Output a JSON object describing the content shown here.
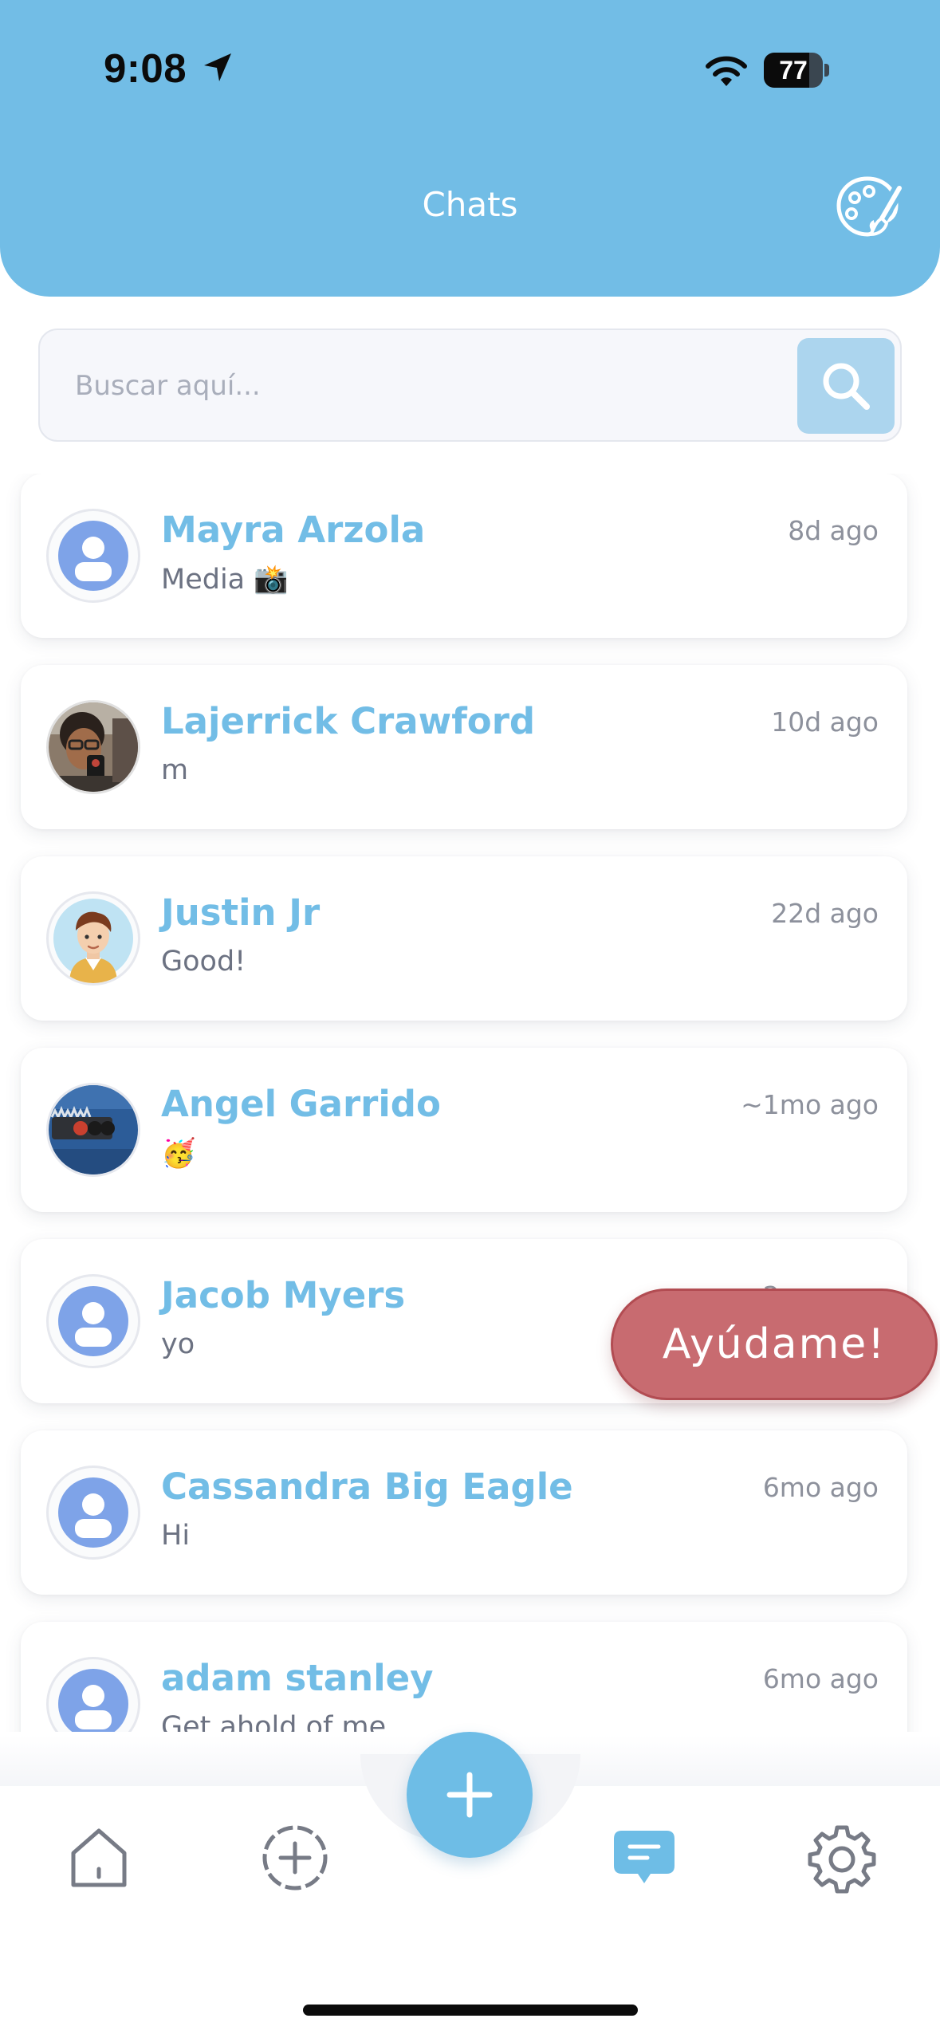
{
  "status_bar": {
    "time": "9:08",
    "battery_percent": "77",
    "battery_level": 0.77
  },
  "header": {
    "title": "Chats",
    "theme_icon": "palette-brush-icon"
  },
  "search": {
    "placeholder": "Buscar aquí...",
    "button_icon": "search-icon"
  },
  "chats": [
    {
      "name": "Mayra Arzola",
      "preview": "Media 📸",
      "time": "8d ago",
      "avatar": "default-avatar"
    },
    {
      "name": "Lajerrick Crawford",
      "preview": "m",
      "time": "10d ago",
      "avatar": "photo-avatar"
    },
    {
      "name": "Justin Jr",
      "preview": "Good!",
      "time": "22d ago",
      "avatar": "cartoon-avatar"
    },
    {
      "name": "Angel Garrido",
      "preview": "🥳",
      "time": "~1mo ago",
      "avatar": "photo-avatar"
    },
    {
      "name": "Jacob Myers",
      "preview": "yo",
      "time": "2mo ago",
      "avatar": "default-avatar"
    },
    {
      "name": "Cassandra Big Eagle",
      "preview": "Hi",
      "time": "6mo ago",
      "avatar": "default-avatar"
    },
    {
      "name": "adam stanley",
      "preview": "Get ahold of me",
      "time": "6mo ago",
      "avatar": "default-avatar"
    }
  ],
  "help_button": {
    "label": "Ayúdame!"
  },
  "bottom_nav": {
    "items": [
      "home-icon",
      "add-circle-icon",
      "chat-icon",
      "settings-icon"
    ],
    "active": "chat-icon",
    "fab_icon": "plus-icon"
  },
  "colors": {
    "accent": "#72bde6",
    "help": "#c86b70",
    "name_text": "#72bde6",
    "preview_text": "#6c7282"
  }
}
